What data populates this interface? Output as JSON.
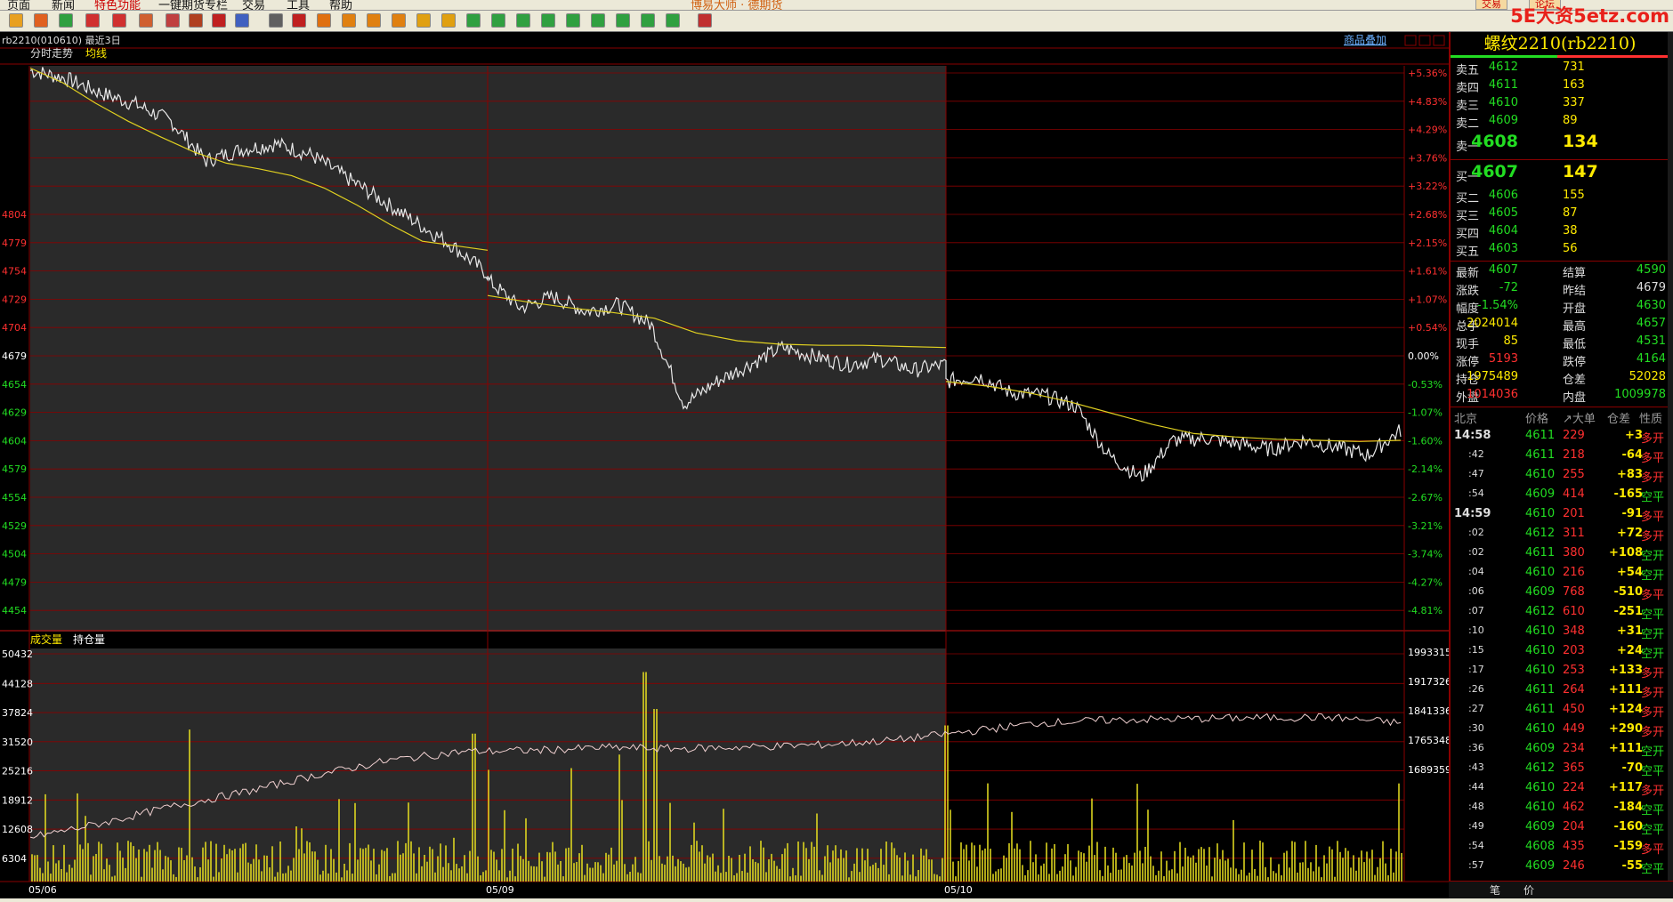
{
  "menu": {
    "items": [
      "页面",
      "新闻",
      "特色功能",
      "一键期货专栏",
      "交易",
      "工具",
      "帮助"
    ],
    "brand": "博易大师 · 德期货",
    "btn_trade": "交易",
    "btn_forum": "论坛"
  },
  "watermark": "5E大资5etz.com",
  "chart": {
    "header_code": "rb2210(010610)  最近3日",
    "label_trend": "分时走势",
    "label_avg": "均线",
    "label_volume": "成交量",
    "label_oi": "持仓量",
    "overlay_link": "商品叠加",
    "date_labels": [
      "05/06",
      "05/09",
      "05/10"
    ],
    "left_ticks": [
      "4804",
      "4779",
      "4754",
      "4729",
      "4704",
      "4679",
      "4654",
      "4629",
      "4604",
      "4579",
      "4554",
      "4529",
      "4504",
      "4479",
      "4454"
    ],
    "right_pct_ticks": [
      "+5.36%",
      "+4.83%",
      "+4.29%",
      "+3.76%",
      "+3.22%",
      "+2.68%",
      "+2.15%",
      "+1.61%",
      "+1.07%",
      "+0.54%",
      "0.00%",
      "-0.53%",
      "-1.07%",
      "-1.60%",
      "-2.14%",
      "-2.67%",
      "-3.21%",
      "-3.74%",
      "-4.27%",
      "-4.81%"
    ],
    "vol_left_ticks": [
      "50432",
      "44128",
      "37824",
      "31520",
      "25216",
      "18912",
      "12608",
      "6304"
    ],
    "vol_right_ticks": [
      "1993315",
      "1917326",
      "1841336",
      "1765348",
      "1689359"
    ]
  },
  "chart_data": {
    "type": "line",
    "title": "螺纹2210(rb2210)",
    "days": [
      "05/06",
      "05/09",
      "05/10"
    ],
    "prev_settle": 4679,
    "price_ylim": [
      4429,
      4929
    ],
    "avg_line": {
      "day1": [
        4927,
        4914,
        4896,
        4880,
        4866,
        4853,
        4843,
        4838,
        4832,
        4821,
        4806,
        4789,
        4774,
        4770,
        4766
      ],
      "day2_3": [
        4726,
        4720,
        4715,
        4711,
        4706,
        4693,
        4686,
        4683,
        4682,
        4682,
        4681,
        4680
      ]
    },
    "oi_ylim": [
      1613000,
      2020000
    ],
    "vol_ylim": [
      0,
      56736
    ]
  },
  "panel": {
    "symbol": "螺纹2210(rb2210)",
    "asks": [
      {
        "label": "卖五",
        "price": "4612",
        "vol": "731"
      },
      {
        "label": "卖四",
        "price": "4611",
        "vol": "163"
      },
      {
        "label": "卖三",
        "price": "4610",
        "vol": "337"
      },
      {
        "label": "卖二",
        "price": "4609",
        "vol": "89"
      },
      {
        "label": "卖一",
        "price": "4608",
        "vol": "134"
      }
    ],
    "bids": [
      {
        "label": "买一",
        "price": "4607",
        "vol": "147"
      },
      {
        "label": "买二",
        "price": "4606",
        "vol": "155"
      },
      {
        "label": "买三",
        "price": "4605",
        "vol": "87"
      },
      {
        "label": "买四",
        "price": "4604",
        "vol": "38"
      },
      {
        "label": "买五",
        "price": "4603",
        "vol": "56"
      }
    ],
    "stats": [
      {
        "l1": "最新",
        "v1": "4607",
        "c1": "#22dd22",
        "l2": "结算",
        "v2": "4590",
        "c2": "#22dd22"
      },
      {
        "l1": "涨跌",
        "v1": "-72",
        "c1": "#22dd22",
        "l2": "昨结",
        "v2": "4679",
        "c2": "#dddddd"
      },
      {
        "l1": "幅度",
        "v1": "-1.54%",
        "c1": "#22dd22",
        "l2": "开盘",
        "v2": "4630",
        "c2": "#22dd22"
      },
      {
        "l1": "总手",
        "v1": "2024014",
        "c1": "#ffea00",
        "l2": "最高",
        "v2": "4657",
        "c2": "#22dd22"
      },
      {
        "l1": "现手",
        "v1": "85",
        "c1": "#ffea00",
        "l2": "最低",
        "v2": "4531",
        "c2": "#22dd22"
      },
      {
        "l1": "涨停",
        "v1": "5193",
        "c1": "#ff3030",
        "l2": "跌停",
        "v2": "4164",
        "c2": "#22dd22"
      },
      {
        "l1": "持仓",
        "v1": "1975489",
        "c1": "#ffea00",
        "l2": "仓差",
        "v2": "52028",
        "c2": "#ffea00"
      },
      {
        "l1": "外盘",
        "v1": "1014036",
        "c1": "#ff3030",
        "l2": "内盘",
        "v2": "1009978",
        "c2": "#22dd22"
      }
    ],
    "tick_header": {
      "time": "北京",
      "price": "价格",
      "vol": "↗大单",
      "oi": "仓差",
      "nature": "性质"
    },
    "ticks": [
      {
        "t": "14:58",
        "p": "4611",
        "v": "229",
        "d": "+3",
        "n": "多开"
      },
      {
        "t": ":42",
        "p": "4611",
        "v": "218",
        "d": "-64",
        "n": "多平"
      },
      {
        "t": ":47",
        "p": "4610",
        "v": "255",
        "d": "+83",
        "n": "多开"
      },
      {
        "t": ":54",
        "p": "4609",
        "v": "414",
        "d": "-165",
        "n": "空平"
      },
      {
        "t": "14:59",
        "p": "4610",
        "v": "201",
        "d": "-91",
        "n": "多平"
      },
      {
        "t": ":02",
        "p": "4612",
        "v": "311",
        "d": "+72",
        "n": "多开"
      },
      {
        "t": ":02",
        "p": "4611",
        "v": "380",
        "d": "+108",
        "n": "空开"
      },
      {
        "t": ":04",
        "p": "4610",
        "v": "216",
        "d": "+54",
        "n": "空开"
      },
      {
        "t": ":06",
        "p": "4609",
        "v": "768",
        "d": "-510",
        "n": "多平"
      },
      {
        "t": ":07",
        "p": "4612",
        "v": "610",
        "d": "-251",
        "n": "空平"
      },
      {
        "t": ":10",
        "p": "4610",
        "v": "348",
        "d": "+31",
        "n": "空开"
      },
      {
        "t": ":15",
        "p": "4610",
        "v": "203",
        "d": "+24",
        "n": "空开"
      },
      {
        "t": ":17",
        "p": "4610",
        "v": "253",
        "d": "+133",
        "n": "多开"
      },
      {
        "t": ":26",
        "p": "4611",
        "v": "264",
        "d": "+111",
        "n": "多开"
      },
      {
        "t": ":27",
        "p": "4611",
        "v": "450",
        "d": "+124",
        "n": "多开"
      },
      {
        "t": ":30",
        "p": "4610",
        "v": "449",
        "d": "+290",
        "n": "多开"
      },
      {
        "t": ":36",
        "p": "4609",
        "v": "234",
        "d": "+111",
        "n": "空开"
      },
      {
        "t": ":43",
        "p": "4612",
        "v": "365",
        "d": "-70",
        "n": "空平"
      },
      {
        "t": ":44",
        "p": "4610",
        "v": "224",
        "d": "+117",
        "n": "多开"
      },
      {
        "t": ":48",
        "p": "4610",
        "v": "462",
        "d": "-184",
        "n": "空平"
      },
      {
        "t": ":49",
        "p": "4609",
        "v": "204",
        "d": "-160",
        "n": "空平"
      },
      {
        "t": ":54",
        "p": "4608",
        "v": "435",
        "d": "-159",
        "n": "多平"
      },
      {
        "t": ":57",
        "p": "4609",
        "v": "246",
        "d": "-55",
        "n": "空平"
      }
    ],
    "bottom_tabs": [
      "笔",
      "价"
    ]
  },
  "colors": {
    "red": "#ff3030",
    "green": "#22dd22",
    "yellow": "#ffea00",
    "grid": "#8a0000",
    "pricewhite": "#e8e8e8"
  }
}
